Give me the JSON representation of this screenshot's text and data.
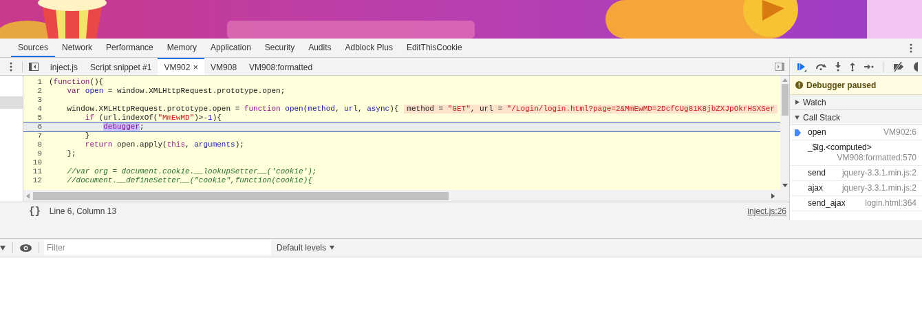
{
  "panel_tabs": [
    {
      "label": "Sources",
      "selected": true
    },
    {
      "label": "Network",
      "selected": false
    },
    {
      "label": "Performance",
      "selected": false
    },
    {
      "label": "Memory",
      "selected": false
    },
    {
      "label": "Application",
      "selected": false
    },
    {
      "label": "Security",
      "selected": false
    },
    {
      "label": "Audits",
      "selected": false
    },
    {
      "label": "Adblock Plus",
      "selected": false
    },
    {
      "label": "EditThisCookie",
      "selected": false
    }
  ],
  "file_tabs": [
    {
      "label": "inject.js",
      "selected": false,
      "closable": false
    },
    {
      "label": "Script snippet #1",
      "selected": false,
      "closable": false
    },
    {
      "label": "VM902",
      "selected": true,
      "closable": true,
      "close": "×"
    },
    {
      "label": "VM908",
      "selected": false,
      "closable": false
    },
    {
      "label": "VM908:formatted",
      "selected": false,
      "closable": false
    }
  ],
  "editor": {
    "lines": [
      {
        "number": "1",
        "current": false,
        "tokens": [
          {
            "kind": "plain",
            "text": "("
          },
          {
            "kind": "keyword",
            "text": "function"
          },
          {
            "kind": "plain",
            "text": "(){"
          }
        ]
      },
      {
        "number": "2",
        "current": false,
        "tokens": [
          {
            "kind": "keyword",
            "text": "    var"
          },
          {
            "kind": "def",
            "text": " open"
          },
          {
            "kind": "plain",
            "text": " = window.XMLHttpRequest.prototype.open;"
          }
        ]
      },
      {
        "number": "3",
        "current": false
      },
      {
        "number": "4",
        "current": false,
        "tokens": [
          {
            "kind": "plain",
            "text": "    window.XMLHttpRequest.prototype.open = "
          },
          {
            "kind": "keyword",
            "text": "function"
          },
          {
            "kind": "def",
            "text": " open"
          },
          {
            "kind": "plain",
            "text": "("
          },
          {
            "kind": "def",
            "text": "method"
          },
          {
            "kind": "plain",
            "text": ", "
          },
          {
            "kind": "def",
            "text": "url"
          },
          {
            "kind": "plain",
            "text": ", "
          },
          {
            "kind": "def",
            "text": "async"
          },
          {
            "kind": "plain",
            "text": "){"
          }
        ],
        "inline_value": [
          {
            "kind": "plain",
            "text": "method = "
          },
          {
            "kind": "string",
            "text": "\"GET\""
          },
          {
            "kind": "plain",
            "text": ", url = "
          },
          {
            "kind": "string",
            "text": "\"/Login/login.html?page=2&MmEwMD=2DcfCUg81K8jbZXJpOkrHSXSer"
          }
        ]
      },
      {
        "number": "5",
        "current": false,
        "tokens": [
          {
            "kind": "keyword",
            "text": "        if"
          },
          {
            "kind": "plain",
            "text": " (url.indexOf("
          },
          {
            "kind": "string",
            "text": "\"MmEwMD\""
          },
          {
            "kind": "plain",
            "text": ")>-"
          },
          {
            "kind": "number",
            "text": "1"
          },
          {
            "kind": "plain",
            "text": "){"
          }
        ]
      },
      {
        "number": "6",
        "current": true,
        "tokens": [
          {
            "kind": "paused",
            "text": "            debugger"
          },
          {
            "kind": "plain",
            "text": ";"
          }
        ]
      },
      {
        "number": "7",
        "current": false,
        "tokens": [
          {
            "kind": "plain",
            "text": "        }"
          }
        ]
      },
      {
        "number": "8",
        "current": false,
        "tokens": [
          {
            "kind": "keyword",
            "text": "        return"
          },
          {
            "kind": "plain",
            "text": " open.apply("
          },
          {
            "kind": "keyword",
            "text": "this"
          },
          {
            "kind": "plain",
            "text": ", "
          },
          {
            "kind": "def",
            "text": "arguments"
          },
          {
            "kind": "plain",
            "text": ");"
          }
        ]
      },
      {
        "number": "9",
        "current": false,
        "tokens": [
          {
            "kind": "plain",
            "text": "    };"
          }
        ]
      },
      {
        "number": "10",
        "current": false
      },
      {
        "number": "11",
        "current": false,
        "tokens": [
          {
            "kind": "comment",
            "text": "    //var org = document.cookie.__lookupSetter__('cookie');"
          }
        ]
      },
      {
        "number": "12",
        "current": false,
        "tokens": [
          {
            "kind": "comment",
            "text": "    //document.__defineSetter__(\"cookie\",function(cookie){"
          }
        ]
      }
    ],
    "format_icon": "{}",
    "cursor_position": "Line 6, Column 13",
    "source_link": "inject.js:26"
  },
  "debugger": {
    "paused_message": "Debugger paused",
    "sections": [
      {
        "title": "Watch",
        "expanded": false
      },
      {
        "title": "Call Stack",
        "expanded": true
      }
    ],
    "call_stack": [
      {
        "name": "open",
        "location": "VM902:6",
        "current": true
      },
      {
        "name": "_$lg.<computed>",
        "location": "VM908:formatted:570",
        "current": false
      },
      {
        "name": "send",
        "location": "jquery-3.3.1.min.js:2",
        "current": false
      },
      {
        "name": "ajax",
        "location": "jquery-3.3.1.min.js:2",
        "current": false
      },
      {
        "name": "send_ajax",
        "location": "login.html:364",
        "current": false
      }
    ]
  },
  "console": {
    "filter": {
      "placeholder": "Filter"
    },
    "levels": "Default levels"
  }
}
